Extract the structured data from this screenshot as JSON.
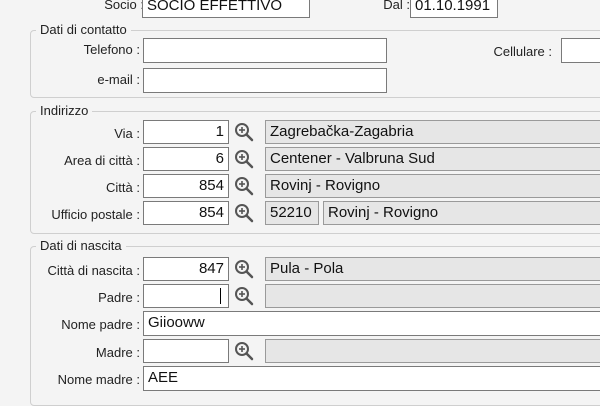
{
  "top": {
    "socio_label": "Socio",
    "socio_value": "SOCIO EFFETTIVO",
    "dal_label": "Dal",
    "dal_value": "01.10.1991"
  },
  "contatto": {
    "title": "Dati di contatto",
    "telefono_label": "Telefono",
    "telefono_value": "",
    "cellulare_label": "Cellulare",
    "cellulare_value": "",
    "email_label": "e-mail",
    "email_value": ""
  },
  "indirizzo": {
    "title": "Indirizzo",
    "via": {
      "label": "Via",
      "code": "1",
      "name": "Zagrebačka-Zagabria"
    },
    "area": {
      "label": "Area di città",
      "code": "6",
      "name": "Centener - Valbruna Sud"
    },
    "citta": {
      "label": "Città",
      "code": "854",
      "name": "Rovinj - Rovigno"
    },
    "ufficio": {
      "label": "Ufficio postale",
      "code": "854",
      "zip": "52210",
      "name": "Rovinj - Rovigno"
    }
  },
  "nascita": {
    "title": "Dati di nascita",
    "citta": {
      "label": "Città di nascita",
      "code": "847",
      "name": "Pula - Pola"
    },
    "padre": {
      "label": "Padre",
      "code": "",
      "name": ""
    },
    "nome_padre": {
      "label": "Nome padre",
      "value": "Giiooww"
    },
    "madre": {
      "label": "Madre",
      "code": "",
      "name": ""
    },
    "nome_madre": {
      "label": "Nome madre",
      "value": "AEE"
    }
  },
  "icons": {
    "lookup": "magnifier-plus-icon"
  }
}
